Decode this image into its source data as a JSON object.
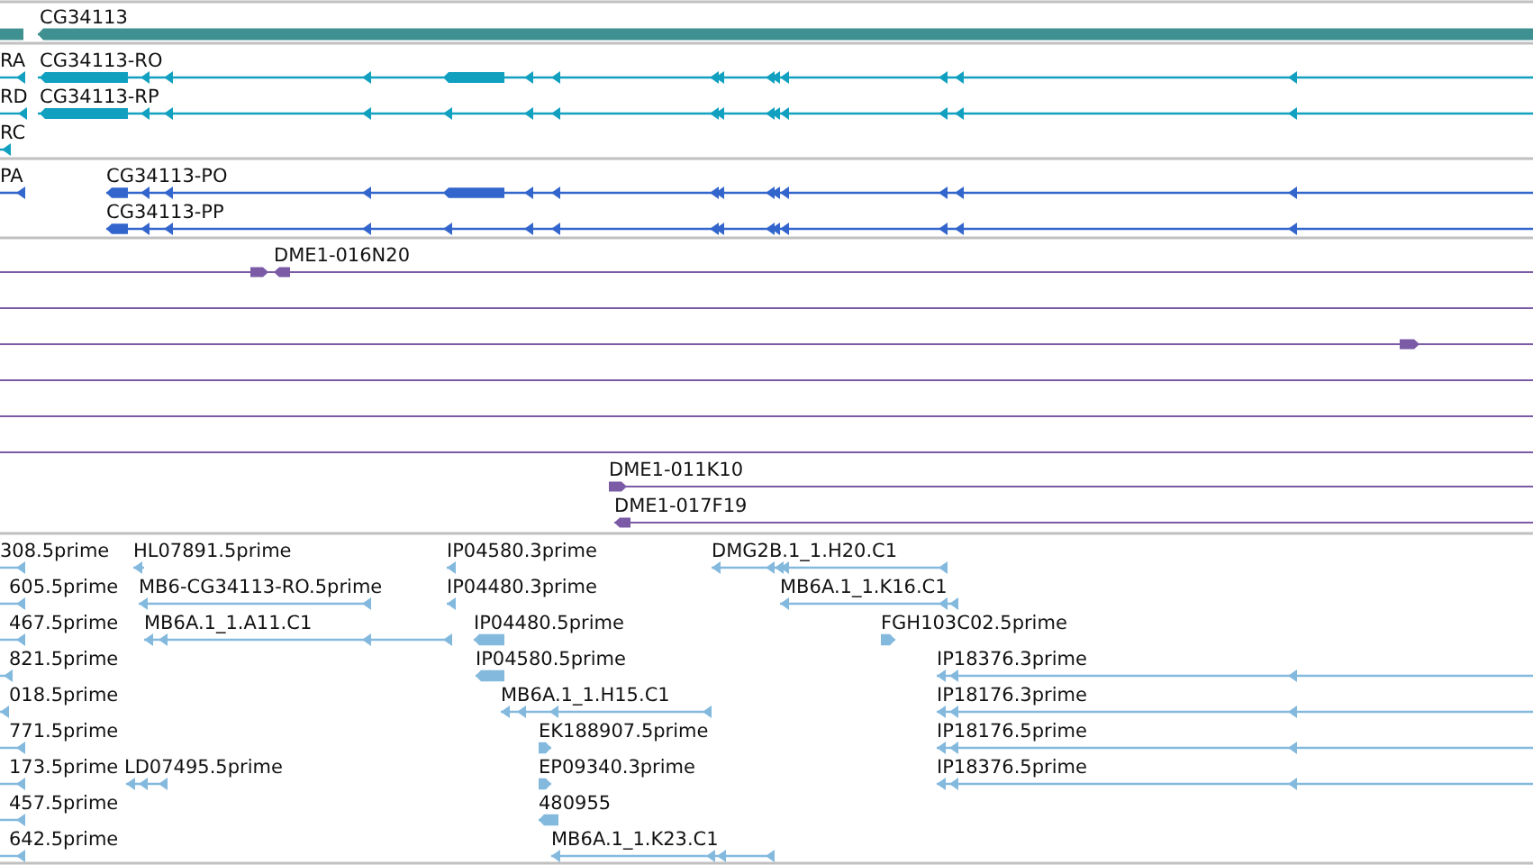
{
  "tracks": [
    {
      "kind": "gene",
      "color": "#3f9090",
      "features": [
        {
          "label": "CG34113"
        }
      ]
    },
    {
      "kind": "transcript",
      "color": "#12a0c0",
      "features": [
        {
          "label": "RA"
        },
        {
          "label": "CG34113-RO"
        },
        {
          "label": "RD"
        },
        {
          "label": "CG34113-RP"
        },
        {
          "label": "RC"
        }
      ]
    },
    {
      "kind": "protein",
      "color": "#3366cc",
      "features": [
        {
          "label": "PA"
        },
        {
          "label": "CG34113-PO"
        },
        {
          "label": "CG34113-PP"
        }
      ]
    },
    {
      "kind": "clone",
      "color": "#7b5aa6",
      "features": [
        {
          "label": "DME1-016N20"
        },
        {
          "label": "DME1-011K10"
        },
        {
          "label": "DME1-017F19"
        }
      ]
    },
    {
      "kind": "est",
      "color": "#84b9de",
      "features": [
        {
          "label": "308.5prime"
        },
        {
          "label": "HL07891.5prime"
        },
        {
          "label": "IP04580.3prime"
        },
        {
          "label": "DMG2B.1_1.H20.C1"
        },
        {
          "label": "605.5prime"
        },
        {
          "label": "MB6-CG34113-RO.5prime"
        },
        {
          "label": "IP04480.3prime"
        },
        {
          "label": "MB6A.1_1.K16.C1"
        },
        {
          "label": "467.5prime"
        },
        {
          "label": "MB6A.1_1.A11.C1"
        },
        {
          "label": "IP04480.5prime"
        },
        {
          "label": "FGH103C02.5prime"
        },
        {
          "label": "821.5prime"
        },
        {
          "label": "IP04580.5prime"
        },
        {
          "label": "IP18376.3prime"
        },
        {
          "label": "018.5prime"
        },
        {
          "label": "MB6A.1_1.H15.C1"
        },
        {
          "label": "IP18176.3prime"
        },
        {
          "label": "771.5prime"
        },
        {
          "label": "EK188907.5prime"
        },
        {
          "label": "IP18176.5prime"
        },
        {
          "label": "173.5prime"
        },
        {
          "label": "LD07495.5prime"
        },
        {
          "label": "EP09340.3prime"
        },
        {
          "label": "IP18376.5prime"
        },
        {
          "label": "457.5prime"
        },
        {
          "label": "480955"
        },
        {
          "label": "642.5prime"
        },
        {
          "label": "MB6A.1_1.K23.C1"
        }
      ]
    }
  ]
}
